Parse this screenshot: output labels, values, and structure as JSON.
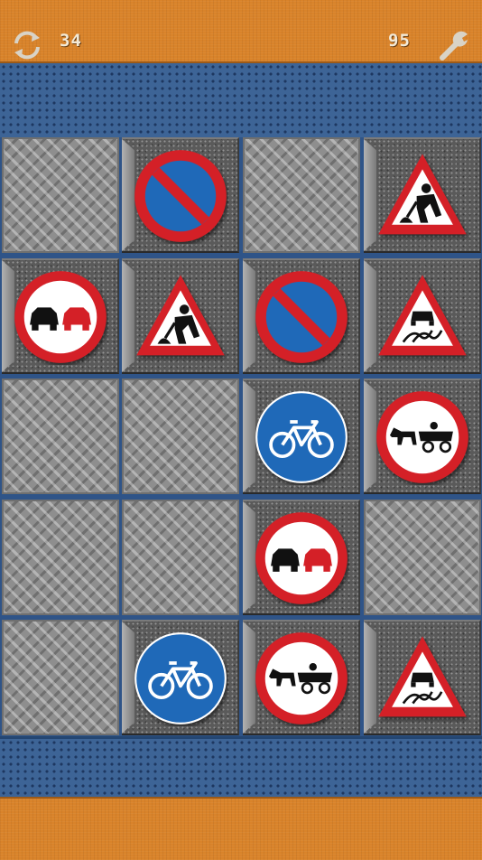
{
  "header": {
    "moves": "34",
    "time": "95",
    "restart_icon": "restart-arrows-icon",
    "settings_icon": "wrench-icon"
  },
  "colors": {
    "header_orange": "#d9832a",
    "board_blue": "#3d6496",
    "sign_red": "#d42027",
    "sign_blue": "#1f69b8"
  },
  "board": {
    "rows": 5,
    "cols": 4,
    "tiles": [
      [
        "empty",
        "no-waiting",
        "empty",
        "roadworks"
      ],
      [
        "no-overtaking",
        "roadworks",
        "no-waiting",
        "slippery-road"
      ],
      [
        "empty",
        "empty",
        "cycle-route",
        "no-horse-drawn-vehicles"
      ],
      [
        "empty",
        "empty",
        "no-overtaking",
        "empty"
      ],
      [
        "empty",
        "cycle-route",
        "no-horse-drawn-vehicles",
        "slippery-road"
      ]
    ]
  }
}
